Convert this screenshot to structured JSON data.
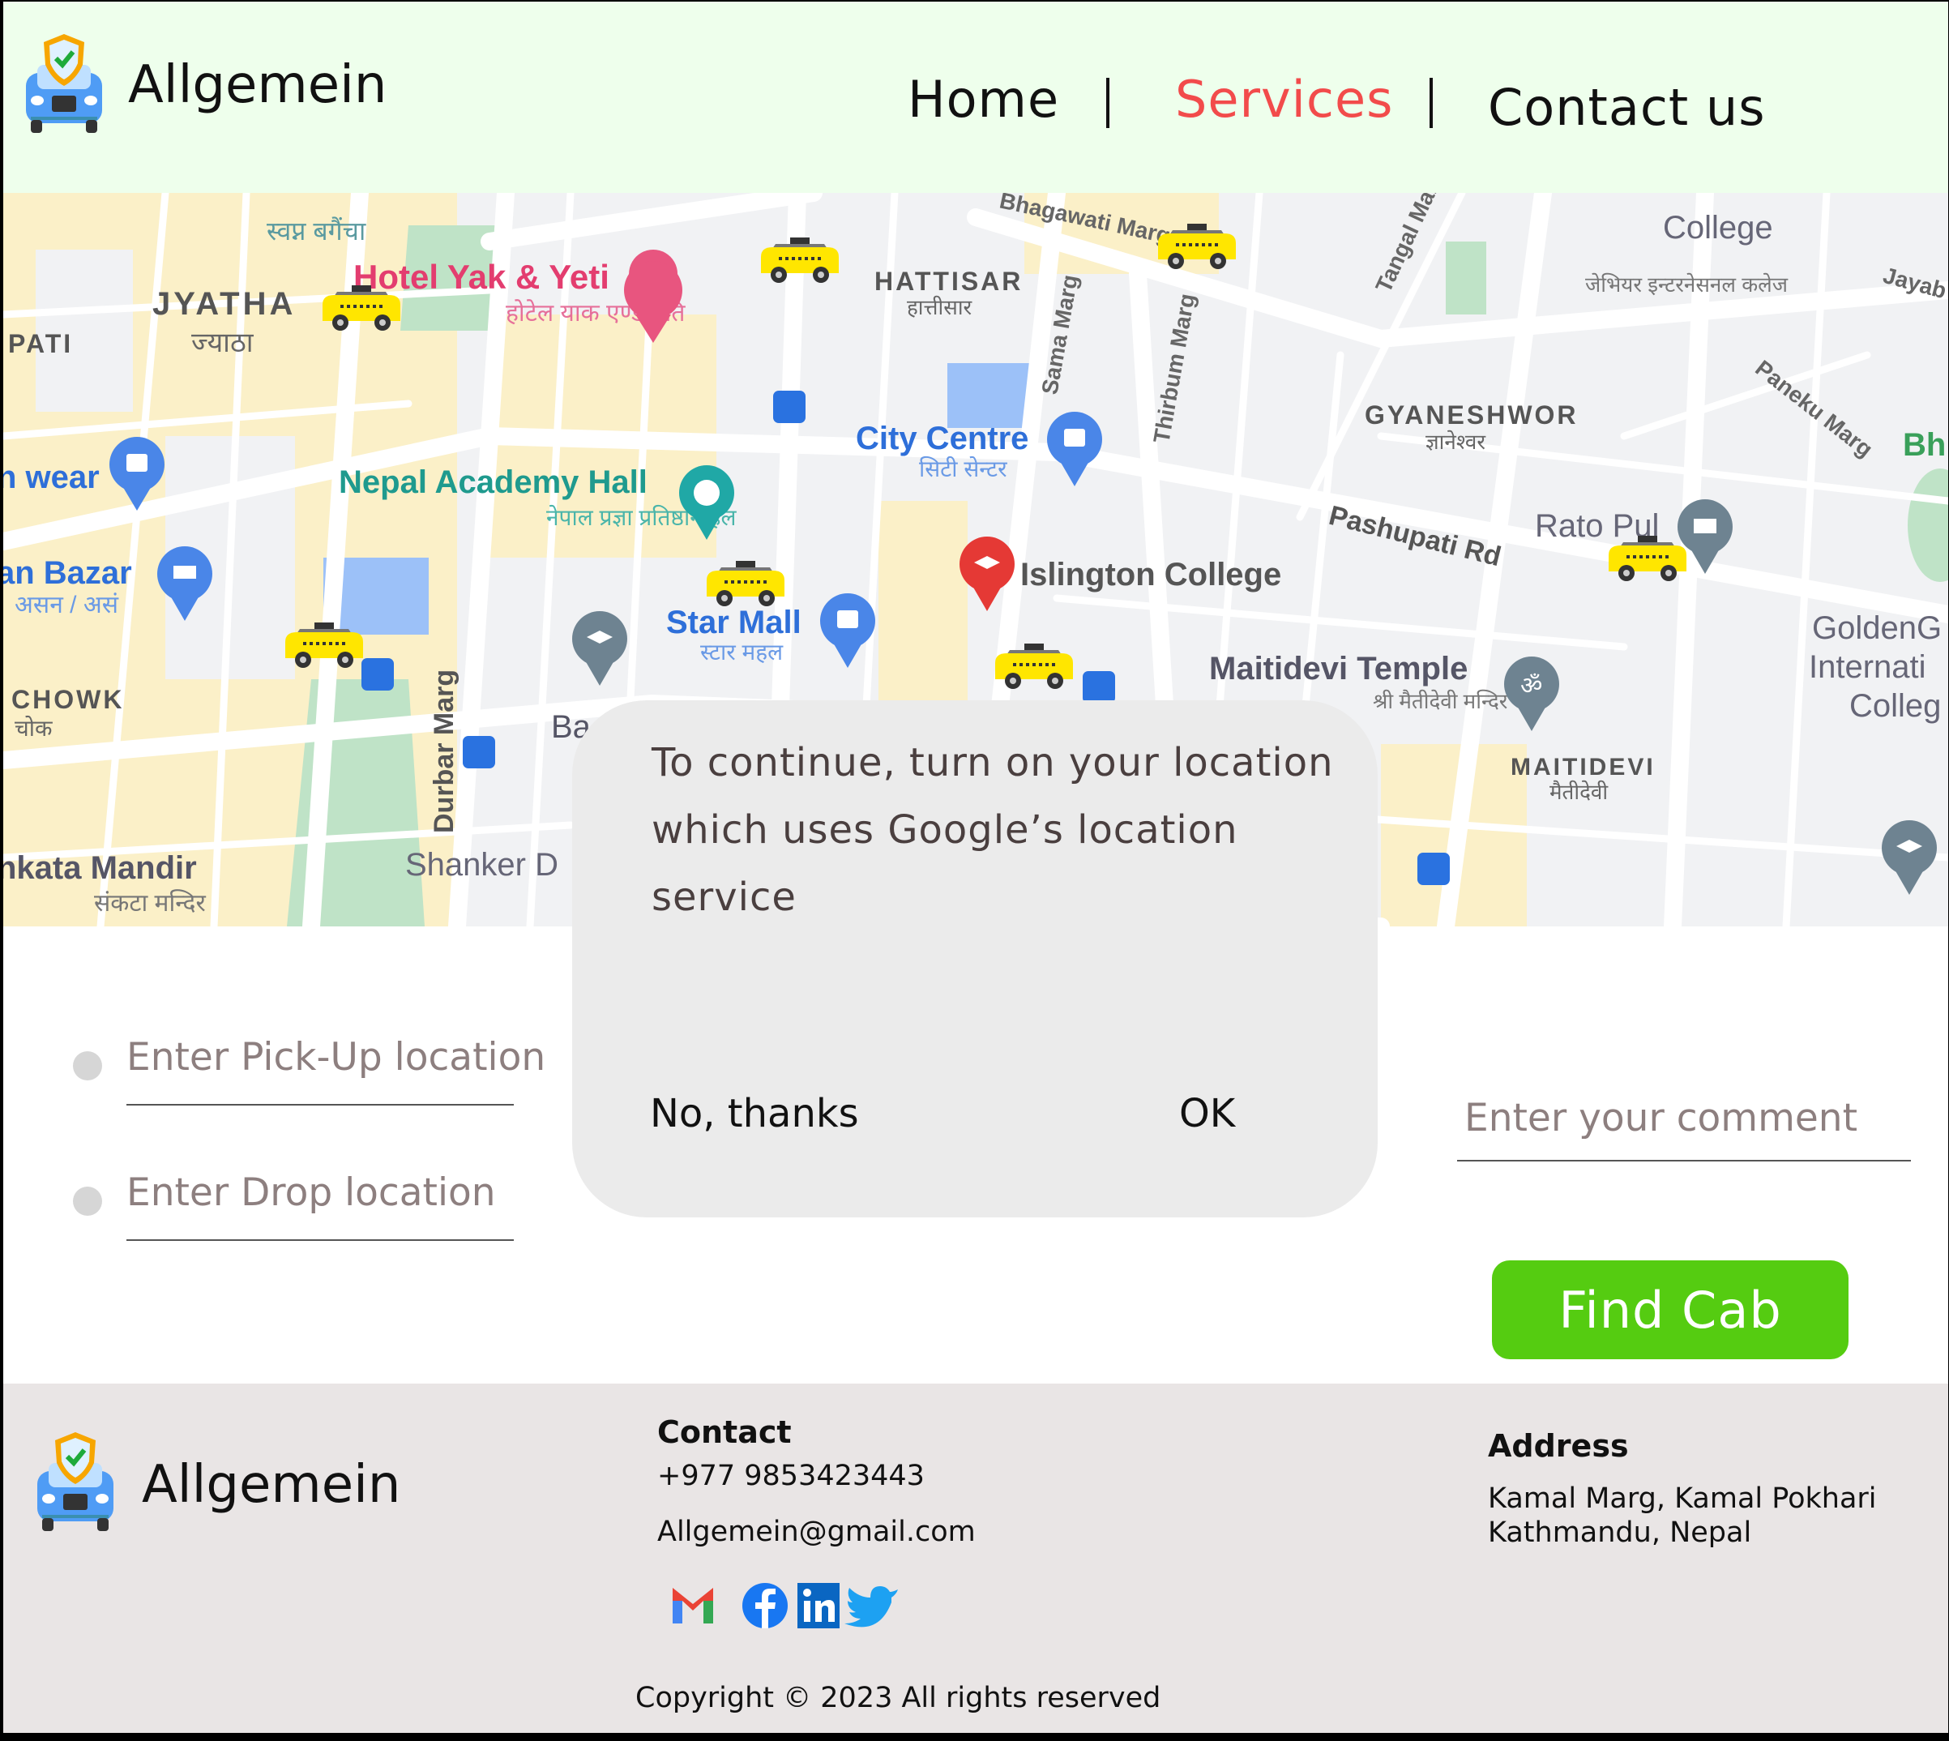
{
  "header": {
    "brand": "Allgemein",
    "nav": [
      {
        "label": "Home",
        "active": false
      },
      {
        "label": "Services",
        "active": true
      },
      {
        "label": "Contact us",
        "active": false
      }
    ],
    "active_color": "#f24b4b"
  },
  "map": {
    "labels": {
      "hotel": "Hotel Yak & Yeti",
      "hotel_np": "होटेल याक एण्ड यति",
      "jyatha": "JYATHA",
      "jyatha_np": "ज्याठा",
      "pati": "PATI",
      "wear": "n wear",
      "bazar": "an Bazar",
      "bazar_np": "असन / असं",
      "chowk": "CHOWK",
      "chowk_np": "चोक",
      "mandir": "nkata Mandir",
      "mandir_np": "संकटा मन्दिर",
      "academy": "Nepal Academy Hall",
      "academy_np": "नेपाल प्रज्ञा प्रतिष्ठान हल",
      "durbar": "Durbar Marg",
      "shanker": "Shanker D",
      "ba": "Ba",
      "star": "Star Mall",
      "star_np": "स्टार महल",
      "city": "City Centre",
      "city_np": "सिटी सेन्टर",
      "hattisar": "HATTISAR",
      "hattisar_np": "हात्तीसार",
      "bhagawati": "Bhagawati Marg",
      "sama": "Sama Marg",
      "thirbum": "Thirbum Marg",
      "tangal": "Tangal Marg",
      "islington": "Islington College",
      "gyaneshwor": "GYANESHWOR",
      "gyaneshwor_np": "ज्ञानेश्वर",
      "pashupati": "Pashupati Rd",
      "ratopul": "Rato Pul",
      "maitidevi_temple": "Maitidevi Temple",
      "maitidevi_temple_np": "श्री मैतीदेवी मन्दिर",
      "maitidevi": "MAITIDEVI",
      "maitidevi_np": "मैतीदेवी",
      "college": "College",
      "college_np": "जेभियर इन्टरनेसनल कलेज",
      "paneku": "Paneku Marg",
      "jayab": "Jayab",
      "golden": "GoldenG",
      "golden2": "Internati",
      "golden3": "Colleg",
      "bh": "Bh",
      "swapna": "स्वप्न बगैंचा"
    }
  },
  "dialog": {
    "message_lines": [
      "To continue, turn on your location",
      "which uses Google’s location",
      "service"
    ],
    "cancel_label": "No, thanks",
    "ok_label": "OK"
  },
  "form": {
    "pickup_placeholder": "Enter Pick-Up location",
    "drop_placeholder": "Enter Drop location",
    "comment_placeholder": "Enter your comment",
    "submit_label": "Find Cab"
  },
  "footer": {
    "brand": "Allgemein",
    "contact_heading": "Contact",
    "phone": "+977 9853423443",
    "email": "Allgemein@gmail.com",
    "address_heading": "Address",
    "address_line1": "Kamal Marg, Kamal Pokhari",
    "address_line2": "Kathmandu, Nepal",
    "social": [
      "gmail-icon",
      "facebook-icon",
      "linkedin-icon",
      "twitter-icon"
    ],
    "copyright": "Copyright © 2023 All rights reserved"
  }
}
